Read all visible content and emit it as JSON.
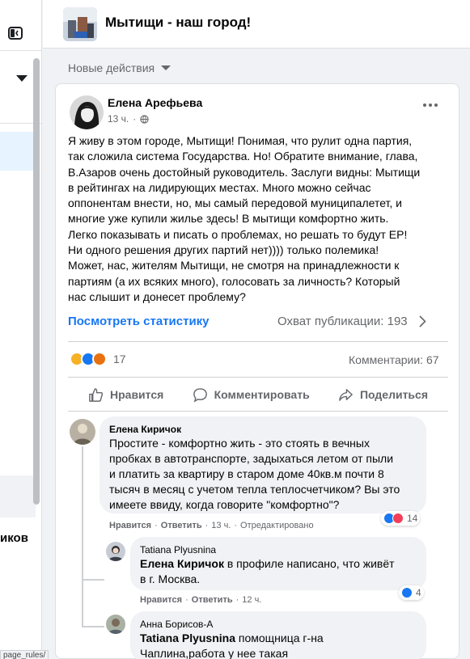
{
  "colors": {
    "accent": "#1877f2",
    "secondary_text": "#65676b",
    "like_blue": "#1877f2",
    "love_red": "#f33e58",
    "haha_yellow": "#f7b125"
  },
  "status_bar": {
    "text": "page_rules/"
  },
  "sidebar": {
    "truncated_label": "иков"
  },
  "group": {
    "title": "Мытищи - наш город!"
  },
  "feed": {
    "filter_label": "Новые действия"
  },
  "post": {
    "author": "Елена Арефьева",
    "time": "13 ч.",
    "text_lines": [
      "Я живу в этом городе, Мытищи! Понимая, что рулит одна партия,",
      "так сложила система Государства. Но! Обратите внимание, глава,",
      "В.Азаров очень достойный руководитель. Заслуги видны: Мытищи",
      "в рейтингах на лидирующих местах. Много можно сейчас",
      "оппонентам внести, но, мы самый передовой муниципалетет, и",
      "многие уже купили жилье здесь! В мытищи комфортно жить.",
      "Легко показывать и писать о проблемах, но решать то будут ЕР!",
      "Ни одного решения других партий нет)))) только полемика!",
      "Может, нас, жителям Мытищи,  не смотря на принадлежности к",
      "партиям (а их всяких много), голосовать за личность? Который",
      "нас слышит и донесет проблему?"
    ],
    "stats_link": "Посмотреть статистику",
    "reach_label": "Охват публикации: 193",
    "reactions_count": "17",
    "comments_count": "Комментарии: 67",
    "actions": {
      "like": "Нравится",
      "comment": "Комментировать",
      "share": "Поделиться"
    }
  },
  "comments": [
    {
      "author": "Елена Киричок",
      "lines": [
        "Простите - комфортно жить - это стоять в вечных",
        "пробках в автотранспорте, задыхаться летом от пыли",
        "и платить за квартиру в старом доме 40кв.м почти 8",
        "тысяч в месяц с учетом тепла теплосчетчиком? Вы это",
        "имеете ввиду, когда говорите \"комфортно\"?"
      ],
      "like": "Нравится",
      "reply": "Ответить",
      "time": "13 ч.",
      "edited": "Отредактировано",
      "reactions": "14"
    },
    {
      "author": "Tatiana Plyusnina",
      "mention": "Елена Киричок",
      "line1_rest": " в профиле написано, что живёт",
      "line2": "в г. Москва.",
      "like": "Нравится",
      "reply": "Ответить",
      "time": "12 ч.",
      "reactions": "4"
    },
    {
      "author": "Анна Борисов-А",
      "mention": "Tatiana Plyusnina",
      "line1_rest": " помощница г-на",
      "line2": "Чаплина,работа у нее такая"
    }
  ],
  "separator": "·"
}
